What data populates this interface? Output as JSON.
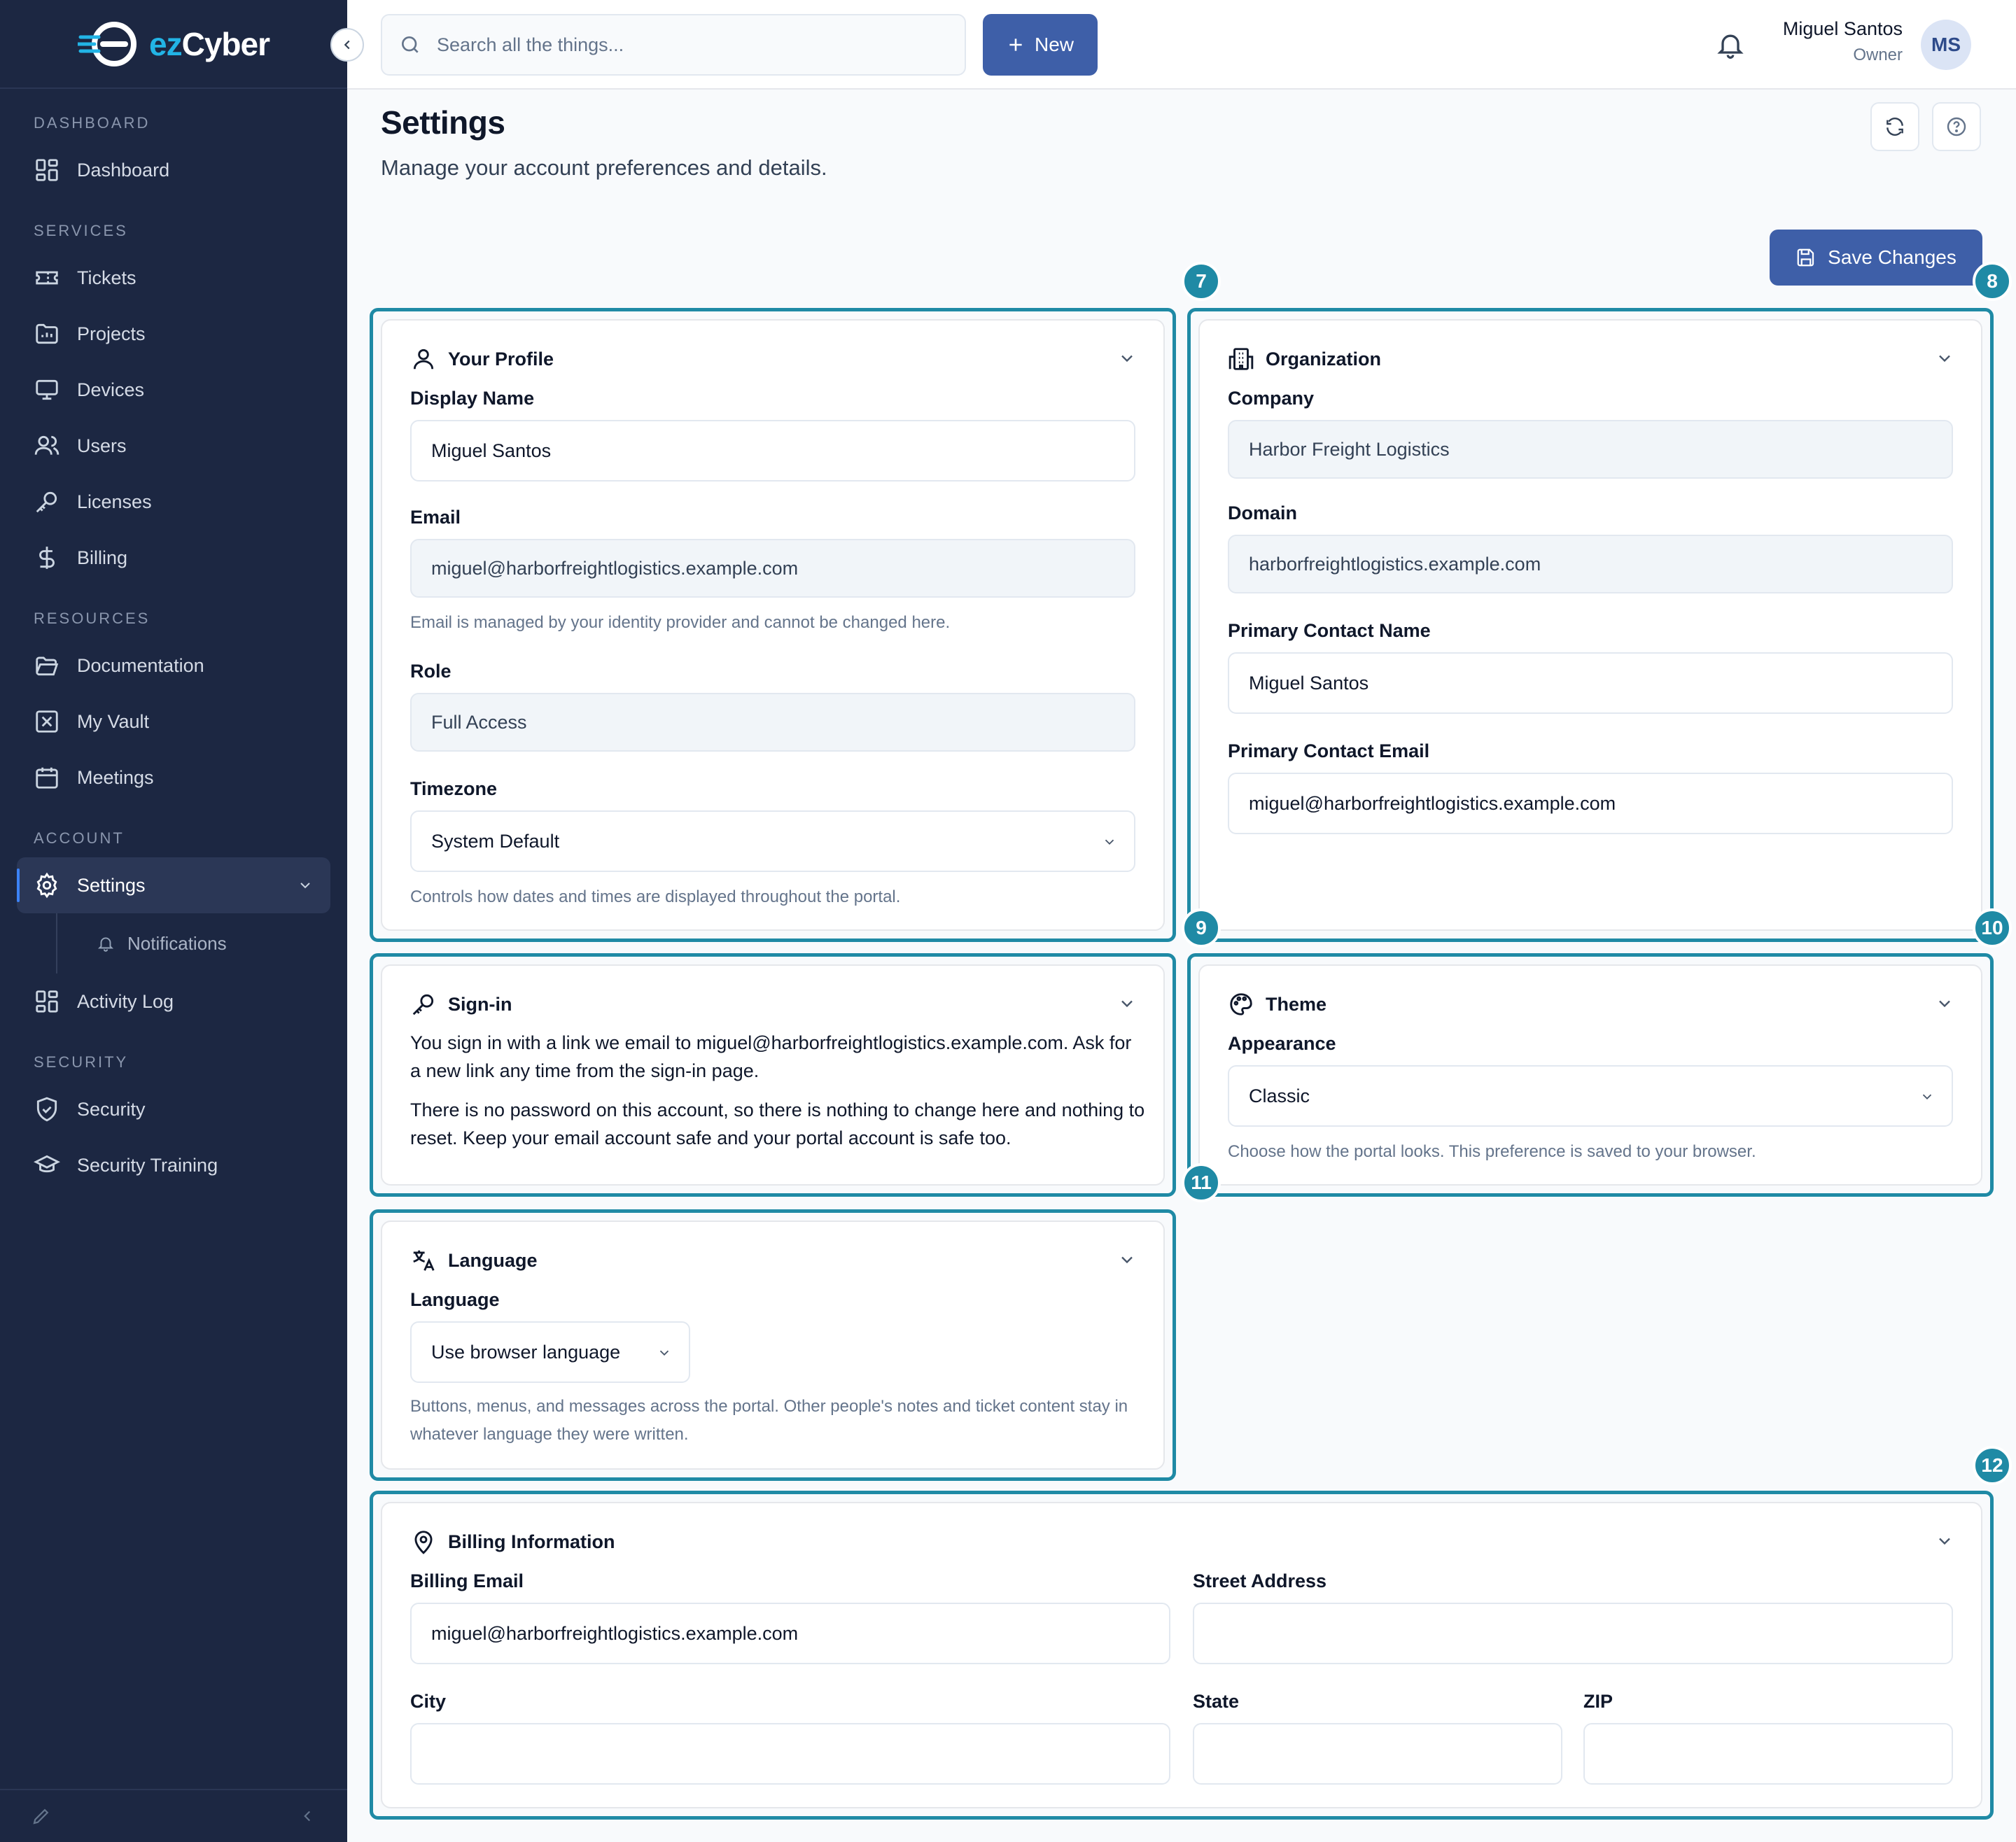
{
  "app": {
    "logo_ez": "ez",
    "logo_cyber": "Cyber"
  },
  "sidebar": {
    "sections": {
      "dashboard": "DASHBOARD",
      "services": "SERVICES",
      "resources": "RESOURCES",
      "account": "ACCOUNT",
      "security": "SECURITY"
    },
    "items": {
      "dashboard": "Dashboard",
      "tickets": "Tickets",
      "projects": "Projects",
      "devices": "Devices",
      "users": "Users",
      "licenses": "Licenses",
      "billing": "Billing",
      "documentation": "Documentation",
      "vault": "My Vault",
      "meetings": "Meetings",
      "settings": "Settings",
      "notifications": "Notifications",
      "activity_log": "Activity Log",
      "security": "Security",
      "security_training": "Security Training"
    }
  },
  "header": {
    "search_placeholder": "Search all the things...",
    "new_label": "New",
    "user_name": "Miguel Santos",
    "user_role": "Owner",
    "avatar_initials": "MS"
  },
  "page": {
    "title": "Settings",
    "subtitle": "Manage your account preferences and details.",
    "save_label": "Save Changes"
  },
  "badges": [
    "7",
    "8",
    "9",
    "10",
    "11",
    "12"
  ],
  "profile": {
    "title": "Your Profile",
    "display_name_label": "Display Name",
    "display_name": "Miguel Santos",
    "email_label": "Email",
    "email": "miguel@harborfreightlogistics.example.com",
    "email_hint": "Email is managed by your identity provider and cannot be changed here.",
    "role_label": "Role",
    "role": "Full Access",
    "timezone_label": "Timezone",
    "timezone": "System Default",
    "timezone_hint": "Controls how dates and times are displayed throughout the portal."
  },
  "organization": {
    "title": "Organization",
    "company_label": "Company",
    "company": "Harbor Freight Logistics",
    "domain_label": "Domain",
    "domain": "harborfreightlogistics.example.com",
    "contact_name_label": "Primary Contact Name",
    "contact_name": "Miguel Santos",
    "contact_email_label": "Primary Contact Email",
    "contact_email": "miguel@harborfreightlogistics.example.com"
  },
  "signin": {
    "title": "Sign-in",
    "para1": "You sign in with a link we email to miguel@harborfreightlogistics.example.com. Ask for a new link any time from the sign-in page.",
    "para2": "There is no password on this account, so there is nothing to change here and nothing to reset. Keep your email account safe and your portal account is safe too."
  },
  "theme": {
    "title": "Theme",
    "appearance_label": "Appearance",
    "appearance": "Classic",
    "hint": "Choose how the portal looks. This preference is saved to your browser."
  },
  "language": {
    "title": "Language",
    "label": "Language",
    "value": "Use browser language",
    "hint": "Buttons, menus, and messages across the portal. Other people's notes and ticket content stay in whatever language they were written."
  },
  "billing": {
    "title": "Billing Information",
    "email_label": "Billing Email",
    "email": "miguel@harborfreightlogistics.example.com",
    "street_label": "Street Address",
    "street": "",
    "city_label": "City",
    "city": "",
    "state_label": "State",
    "state": "",
    "zip_label": "ZIP",
    "zip": ""
  },
  "colors": {
    "sidebar_bg": "#1c2742",
    "accent": "#3e5fa8",
    "highlight": "#1f8aa5"
  }
}
